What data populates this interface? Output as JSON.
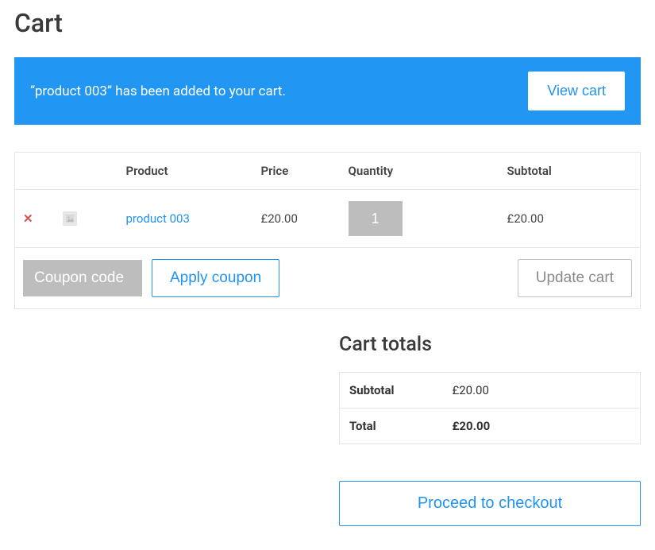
{
  "page": {
    "title": "Cart"
  },
  "notice": {
    "message": "“product 003” has been added to your cart.",
    "view_cart_label": "View cart"
  },
  "table": {
    "headers": {
      "product": "Product",
      "price": "Price",
      "quantity": "Quantity",
      "subtotal": "Subtotal"
    },
    "items": [
      {
        "name": "product 003",
        "price": "£20.00",
        "quantity": "1",
        "subtotal": "£20.00"
      }
    ],
    "coupon_placeholder": "Coupon code",
    "apply_coupon_label": "Apply coupon",
    "update_cart_label": "Update cart"
  },
  "totals": {
    "heading": "Cart totals",
    "subtotal_label": "Subtotal",
    "subtotal_value": "£20.00",
    "total_label": "Total",
    "total_value": "£20.00",
    "proceed_label": "Proceed to checkout"
  }
}
